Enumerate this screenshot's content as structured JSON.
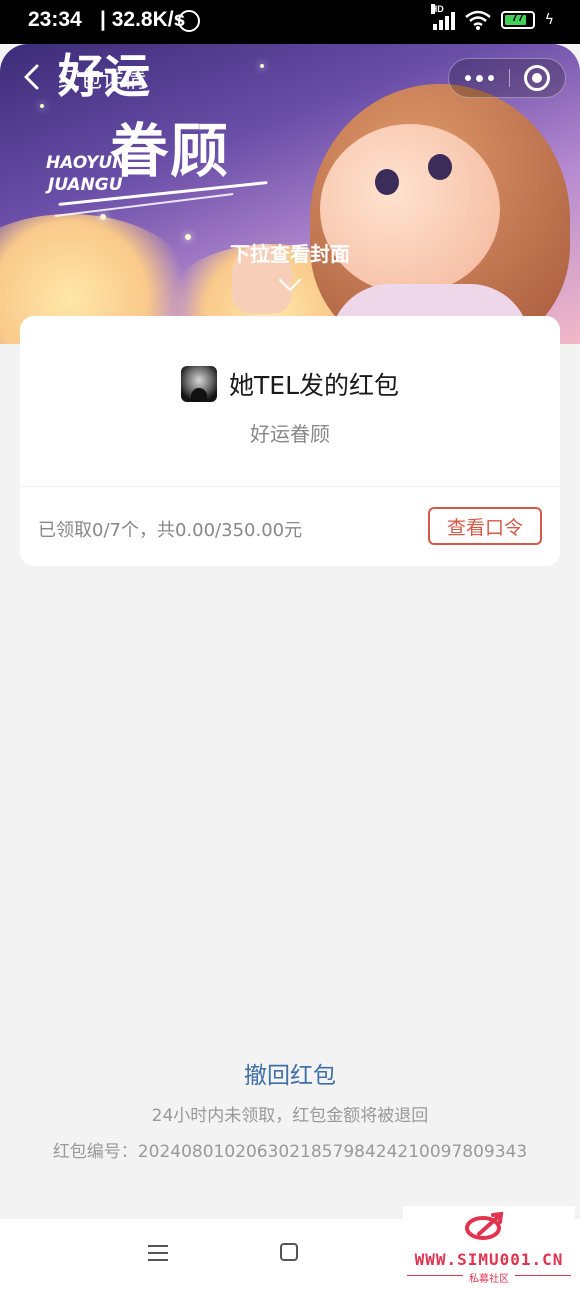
{
  "status_bar": {
    "time": "23:34",
    "speed": "| 32.8K/s",
    "network": "HD",
    "battery": "77"
  },
  "header": {
    "title": "红包详情",
    "cover_title_top": "好运",
    "cover_title": "眷顾",
    "cover_pinyin_line1": "HAOYUN",
    "cover_pinyin_line2": "JUANGU",
    "pull_hint": "下拉查看封面"
  },
  "card": {
    "sender": "她TEL发的红包",
    "greeting": "好运眷顾",
    "claimed_text": "已领取0/7个，共0.00/350.00元",
    "view_button": "查看口令",
    "accent_color": "#d45a47"
  },
  "footer": {
    "withdraw": "撤回红包",
    "refund_note": "24小时内未领取，红包金额将被退回",
    "serial": "红包编号：20240801020630218579842421009780934 3"
  },
  "watermark": {
    "site": "WWW.SIMU001.CN",
    "label": "私募社区"
  }
}
